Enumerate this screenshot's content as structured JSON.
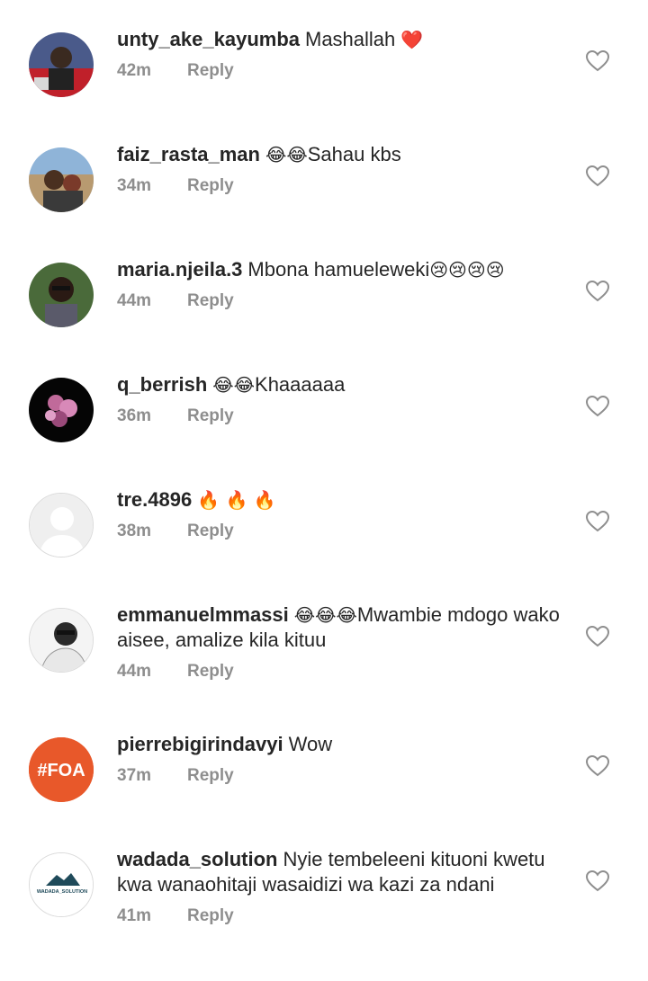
{
  "comments": [
    {
      "username": "unty_ake_kayumba",
      "text": "Mashallah",
      "emoji": "❤️",
      "emoji_after": true,
      "time": "42m",
      "reply": "Reply"
    },
    {
      "username": "faiz_rasta_man",
      "emoji": "😂😂",
      "text": "Sahau kbs",
      "time": "34m",
      "reply": "Reply"
    },
    {
      "username": "maria.njeila.3",
      "text": "Mbona hamueleweki",
      "emoji": "😢😢😢😢",
      "emoji_after": true,
      "time": "44m",
      "reply": "Reply"
    },
    {
      "username": "q_berrish",
      "emoji": "😂😂",
      "text": "Khaaaaaa",
      "time": "36m",
      "reply": "Reply"
    },
    {
      "username": "tre.4896",
      "emoji": "🔥 🔥 🔥",
      "text": "",
      "time": "38m",
      "reply": "Reply"
    },
    {
      "username": "emmanuelmmassi",
      "emoji": "😂😂😂",
      "text": "Mwambie mdogo wako aisee, amalize kila kituu",
      "time": "44m",
      "reply": "Reply"
    },
    {
      "username": "pierrebigirindavyi",
      "emoji": "",
      "text": "Wow",
      "time": "37m",
      "reply": "Reply"
    },
    {
      "username": "wadada_solution",
      "emoji": "",
      "text": "Nyie tembeleeni kituoni kwetu kwa wanaohitaji wasaidizi wa kazi za ndani",
      "time": "41m",
      "reply": "Reply"
    }
  ],
  "avatars": {
    "pierre_badge": "#FOA",
    "wadada_logo": "WADADA_SOLUTION"
  },
  "colors": {
    "text": "#262626",
    "meta": "#8e8e8e",
    "heart": "#e0245e",
    "foa_orange": "#e8582a"
  }
}
